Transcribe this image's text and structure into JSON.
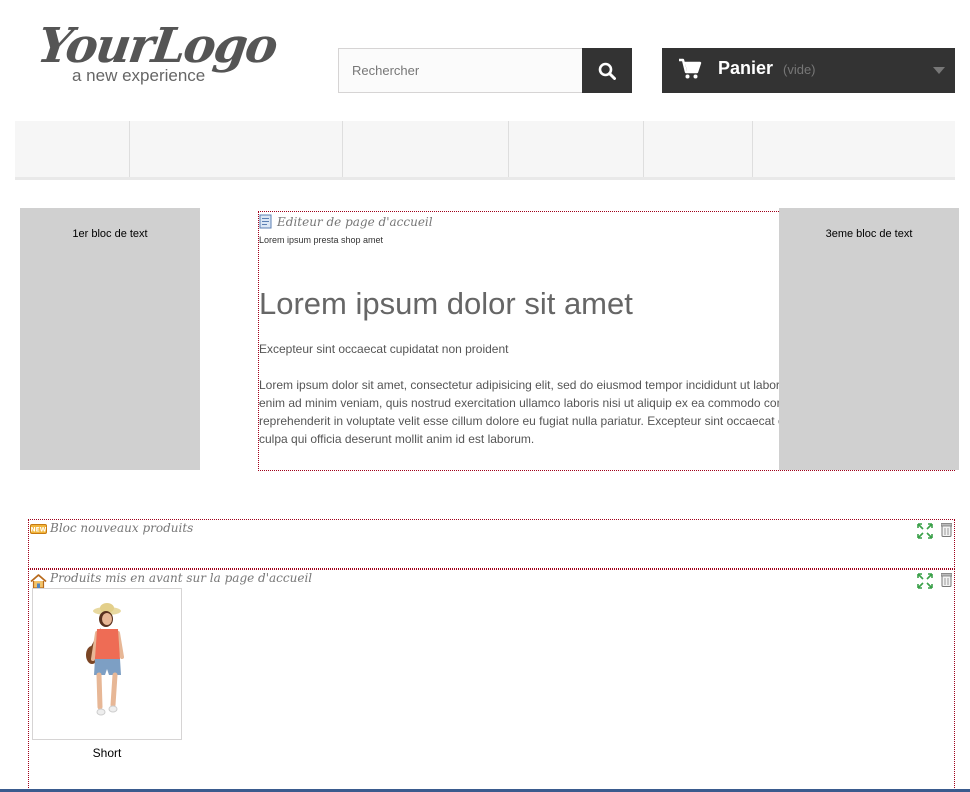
{
  "header": {
    "logo": {
      "script": "YourLogo",
      "tagline": "a new experience"
    },
    "search": {
      "placeholder": "Rechercher",
      "value": ""
    },
    "cart": {
      "label": "Panier",
      "status": "(vide)"
    }
  },
  "menu": {
    "tabs": [
      "",
      "",
      "",
      "",
      ""
    ]
  },
  "blocks": {
    "left": {
      "text": "1er bloc de text"
    },
    "right": {
      "text": "3eme bloc de text"
    }
  },
  "editor": {
    "module_title": "Editeur de page d'accueil",
    "subtitle": "Lorem ipsum presta shop amet",
    "headline": "Lorem ipsum dolor sit amet",
    "lead": "Excepteur sint occaecat cupidatat non proident",
    "body": "Lorem ipsum dolor sit amet, consectetur adipisicing elit, sed do eiusmod tempor incididunt ut labore et dolore magna aliqua. Ut enim ad minim veniam, quis nostrud exercitation ullamco laboris nisi ut aliquip ex ea commodo consequat. Duis aute irure dolor in reprehenderit in voluptate velit esse cillum dolore eu fugiat nulla pariatur. Excepteur sint occaecat cupidatat non proident, sunt in culpa qui officia deserunt mollit anim id est laborum."
  },
  "modules": {
    "new_products": {
      "title": "Bloc nouveaux produits",
      "icon": "new-badge-icon"
    },
    "featured": {
      "title": "Produits mis en avant sur la page d'accueil",
      "icon": "home-icon",
      "products": [
        {
          "name": "Short"
        }
      ]
    }
  },
  "colors": {
    "dark": "#333333",
    "menu_bg": "#f6f6f6",
    "block_gray": "#d0d0d0",
    "module_border": "#a0001a",
    "drag_dash": "#e00000"
  }
}
